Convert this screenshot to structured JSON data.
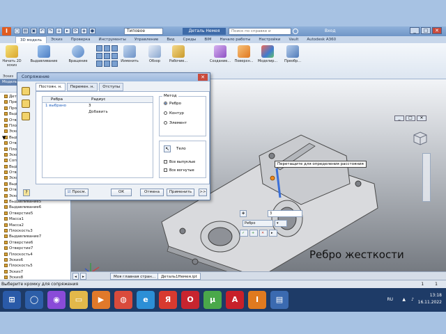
{
  "titlebar": {
    "style_combo": "Типовое",
    "app_title": "Деталь Немея",
    "search_placeholder": "Поиск по справке и командам",
    "user": "Вход",
    "minimize": "_",
    "maximize": "□",
    "close": "✕"
  },
  "menu": {
    "items": [
      "3D модель",
      "Эскиз",
      "Проверка",
      "Инструменты",
      "Управление",
      "Вид",
      "Среды",
      "BIM",
      "Начало работы",
      "Настройки",
      "Vault",
      "Autodesk A360"
    ]
  },
  "ribbon": {
    "sketch_label": "Начать 2D эскиз",
    "sketch_group": "Эскиз",
    "buttons": [
      "Выдавливание",
      "Вращение",
      "Изменить",
      "Обзор",
      "Рабочие...",
      "Создание...",
      "Поверхн...",
      "Моделир...",
      "Преобр..."
    ]
  },
  "browser": {
    "title": "Модель",
    "items": [
      "Деталь",
      "Представления",
      "Происхождение",
      "Выдавливание1",
      "Отверстие1",
      "Плоскость1",
      "Эскиз2",
      "Выдавливание2",
      "Отверстие2",
      "Плоскость2",
      "Эскиз3",
      "Сопряжение1",
      "Выдавливание3",
      "Отверстие3",
      "Эскиз4",
      "Выдавливание4",
      "Отверстие4",
      "Эскиз5",
      "Выдавливание5",
      "Выдавливание6",
      "Отверстие5",
      "Масса1",
      "Масса2",
      "Плоскость3",
      "Выдавливание7",
      "Отверстие6",
      "Отверстие7",
      "Плоскость4",
      "Эскиз6",
      "Плоскость5",
      "Эскиз7",
      "Эскиз8"
    ]
  },
  "dialog": {
    "title": "Сопряжение",
    "close": "✕",
    "tabs": [
      "Постоян. н.",
      "Перемен. н.",
      "Отступы"
    ],
    "table_headers": [
      "Ребра",
      "Радиус"
    ],
    "rows": [
      {
        "edge": "1 выбрано",
        "radius": "3"
      }
    ],
    "add_label": "Добавить",
    "method_label": "Метод",
    "method_options": [
      "Ребро",
      "Контур",
      "Элемент"
    ],
    "selected_method": "Ребро",
    "all_fillets": "Все выпуклые",
    "all_rounds": "Все вогнутые",
    "solid_label": "Тело",
    "preview_label": "Просм.",
    "ok": "ОК",
    "cancel": "Отмена",
    "apply": "Применить",
    "more": ">>"
  },
  "viewport": {
    "tooltip": "Перетащите для определения расстояния",
    "mini_value": "3",
    "mini_dropdown": "Ребро",
    "caption": "Ребро жесткости"
  },
  "document_tabs": [
    "Моя главная стран...",
    "Деталь1Немея.ipt"
  ],
  "status": {
    "prompt": "Выберите кромку для сопряжения",
    "num1": "1",
    "num2": "1"
  },
  "taskbar": {
    "lang": "RU",
    "time": "13:18",
    "date": "16.11.2022"
  },
  "colors": {
    "accent": "#3d6aa8",
    "taskbar": "#1e3b67",
    "preview_edge": "#3a6fd8"
  }
}
